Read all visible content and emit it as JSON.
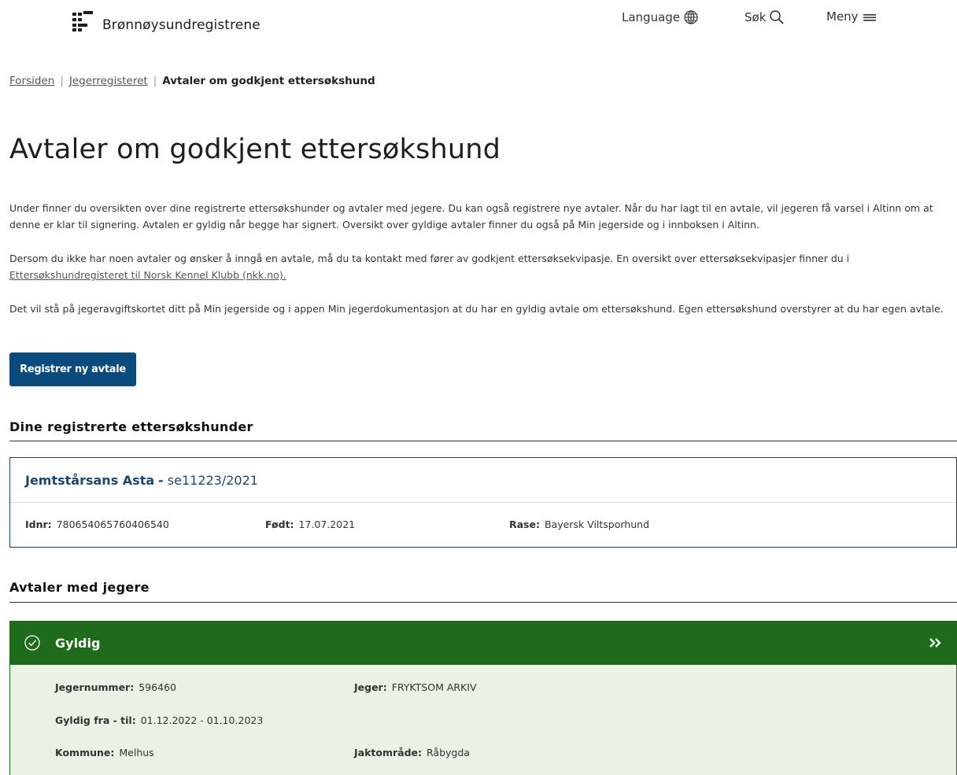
{
  "header": {
    "brand": "Brønnøysundregistrene",
    "nav": [
      {
        "label": "Language",
        "icon": "globe-icon"
      },
      {
        "label": "Søk",
        "icon": "search-icon"
      },
      {
        "label": "Meny",
        "icon": "hamburger-menu-icon"
      }
    ]
  },
  "breadcrumb": {
    "items": [
      "Forsiden",
      "Jegerregisteret"
    ],
    "separator": "|",
    "current": "Avtaler om godkjent ettersøkshund"
  },
  "page_title": "Avtaler om godkjent ettersøkshund",
  "intro": {
    "p1": "Under finner du oversikten over dine registrerte ettersøkshunder og avtaler med jegere. Du kan også registrere nye avtaler. Når du har lagt til en avtale, vil jegeren få varsel i Altinn om at denne er klar til signering. Avtalen er gyldig når begge har signert. Oversikt over gyldige avtaler finner du også på Min jegerside og i innboksen i Altinn.",
    "p2_text": "Dersom du ikke har noen avtaler og ønsker å inngå en avtale, må du ta kontakt med fører av godkjent ettersøksekvipasje. En oversikt over ettersøksekvipasjer finner du i ",
    "p2_link": "Ettersøkshundregisteret til Norsk Kennel Klubb (nkk.no).",
    "p3": "Det vil stå på jegeravgiftskortet ditt på Min jegerside og i appen Min jegerdokumentasjon at du har en gyldig avtale om ettersøkshund. Egen ettersøkshund overstyrer at du har egen avtale."
  },
  "register_button": "Registrer ny avtale",
  "dogs_section": {
    "title": "Dine registrerte ettersøkshunder",
    "dog": {
      "name": "Jemtstårsans Asta",
      "separator": "-",
      "reg_no": "se11223/2021",
      "idnr_label": "Idnr:",
      "idnr": "780654065760406540",
      "born_label": "Født:",
      "born": "17.07.2021",
      "breed_label": "Rase:",
      "breed": "Bayersk Viltsporhund"
    }
  },
  "agreements_section": {
    "title": "Avtaler med jegere",
    "agreement": {
      "status": "Gyldig",
      "status_icon": "check-circle-icon",
      "expand_icon": "double-chevron-right-icon",
      "hunter_no_label": "Jegernummer:",
      "hunter_no": "596460",
      "hunter_label": "Jeger:",
      "hunter": "FRYKTSOM ARKIV",
      "valid_label": "Gyldig fra - til:",
      "valid": "01.12.2022 - 01.10.2023",
      "municipality_label": "Kommune:",
      "municipality": "Melhus",
      "area_label": "Jaktområde:",
      "area": "Råbygda"
    }
  },
  "colors": {
    "primary_button": "#0b4a7c",
    "valid_green": "#1e6b1c",
    "valid_bg": "#e9f2e5",
    "dog_link": "#1c4670"
  }
}
